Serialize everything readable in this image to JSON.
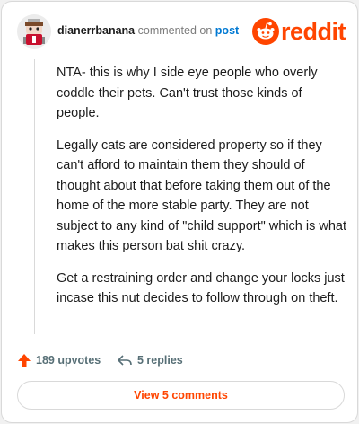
{
  "header": {
    "username": "dianerrbanana",
    "commented_on": "commented on",
    "post_link": "post",
    "brand": "reddit"
  },
  "comment": {
    "paragraphs": [
      "NTA- this is why I side eye people who overly coddle their pets. Can't trust those kinds of people.",
      "Legally cats are considered property so if they can't afford to maintain them they should of thought about that before taking them out of the home of the more stable party. They are not subject to any kind of \"child support\" which is what makes this person bat shit crazy.",
      "Get a restraining order and change your locks just incase this nut decides to follow through on theft."
    ]
  },
  "actions": {
    "upvotes": "189 upvotes",
    "replies": "5 replies"
  },
  "footer": {
    "view_comments": "View 5 comments"
  },
  "colors": {
    "brand": "#ff4500",
    "link": "#0079d3",
    "text": "#1c1c1c",
    "muted": "#576f76"
  },
  "icons": {
    "upvote": "upvote-arrow-icon",
    "reply": "reply-arrow-icon",
    "logo": "reddit-snoo-icon"
  }
}
